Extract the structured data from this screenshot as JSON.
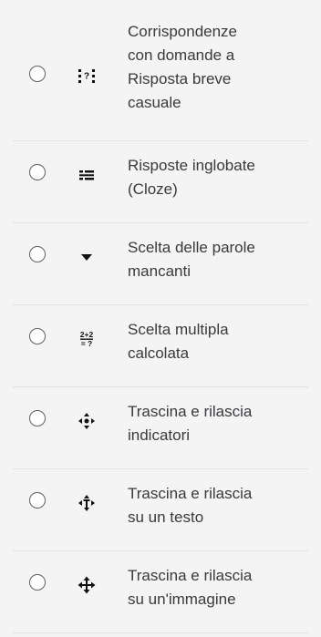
{
  "options": [
    {
      "label_lines": [
        "Corrispondenze",
        "con domande a",
        "Risposta breve",
        "casuale"
      ],
      "icon": "random-short-answer-match-icon"
    },
    {
      "label_lines": [
        "Risposte inglobate",
        "(Cloze)"
      ],
      "icon": "cloze-icon"
    },
    {
      "label_lines": [
        "Scelta delle parole",
        "mancanti"
      ],
      "icon": "select-missing-words-icon"
    },
    {
      "label_lines": [
        "Scelta multipla",
        "calcolata"
      ],
      "icon": "calculated-multichoice-icon"
    },
    {
      "label_lines": [
        "Trascina e rilascia",
        "indicatori"
      ],
      "icon": "drag-drop-markers-icon"
    },
    {
      "label_lines": [
        "Trascina e rilascia",
        "su un testo"
      ],
      "icon": "drag-drop-text-icon"
    },
    {
      "label_lines": [
        "Trascina e rilascia",
        "su un'immagine"
      ],
      "icon": "drag-drop-image-icon"
    }
  ]
}
